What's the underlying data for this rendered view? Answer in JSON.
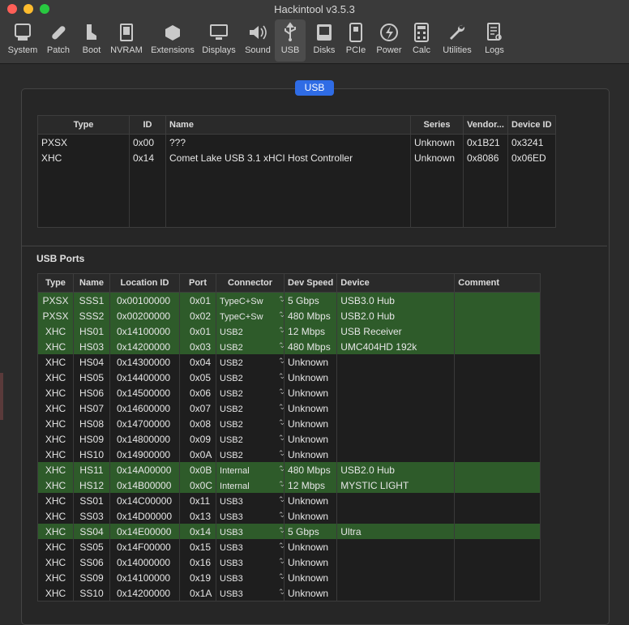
{
  "window": {
    "title": "Hackintool v3.5.3",
    "lights": [
      "#ff5f57",
      "#febc2e",
      "#28c840"
    ]
  },
  "toolbar": [
    {
      "label": "System",
      "icon": "system-icon"
    },
    {
      "label": "Patch",
      "icon": "bandage-icon"
    },
    {
      "label": "Boot",
      "icon": "boot-icon"
    },
    {
      "label": "NVRAM",
      "icon": "nvram-icon"
    },
    {
      "label": "Extensions",
      "icon": "extensions-icon"
    },
    {
      "label": "Displays",
      "icon": "display-icon"
    },
    {
      "label": "Sound",
      "icon": "speaker-icon"
    },
    {
      "label": "USB",
      "icon": "usb-icon"
    },
    {
      "label": "Disks",
      "icon": "disk-icon"
    },
    {
      "label": "PCIe",
      "icon": "pcie-icon"
    },
    {
      "label": "Power",
      "icon": "power-icon"
    },
    {
      "label": "Calc",
      "icon": "calculator-icon"
    },
    {
      "label": "Utilities",
      "icon": "wrench-icon"
    },
    {
      "label": "Logs",
      "icon": "logs-icon"
    }
  ],
  "segment": {
    "label": "USB"
  },
  "controllers": {
    "headers": [
      "Type",
      "ID",
      "Name",
      "Series",
      "Vendor...",
      "Device ID"
    ],
    "rows": [
      [
        "PXSX",
        "0x00",
        "???",
        "Unknown",
        "0x1B21",
        "0x3241"
      ],
      [
        "XHC",
        "0x14",
        "Comet Lake USB 3.1 xHCI Host Controller",
        "Unknown",
        "0x8086",
        "0x06ED"
      ]
    ]
  },
  "ports_section": {
    "title": "USB Ports"
  },
  "ports": {
    "headers": [
      "Type",
      "Name",
      "Location ID",
      "Port",
      "Connector",
      "Dev Speed",
      "Device",
      "Comment"
    ],
    "rows": [
      {
        "type": "PXSX",
        "name": "SSS1",
        "loc": "0x00100000",
        "port": "0x01",
        "conn": "TypeC+Sw",
        "speed": "5 Gbps",
        "device": "USB3.0 Hub",
        "comment": "",
        "active": true
      },
      {
        "type": "PXSX",
        "name": "SSS2",
        "loc": "0x00200000",
        "port": "0x02",
        "conn": "TypeC+Sw",
        "speed": "480 Mbps",
        "device": "USB2.0 Hub",
        "comment": "",
        "active": true
      },
      {
        "type": "XHC",
        "name": "HS01",
        "loc": "0x14100000",
        "port": "0x01",
        "conn": "USB2",
        "speed": "12 Mbps",
        "device": "USB Receiver",
        "comment": "",
        "active": true
      },
      {
        "type": "XHC",
        "name": "HS03",
        "loc": "0x14200000",
        "port": "0x03",
        "conn": "USB2",
        "speed": "480 Mbps",
        "device": "UMC404HD 192k",
        "comment": "",
        "active": true
      },
      {
        "type": "XHC",
        "name": "HS04",
        "loc": "0x14300000",
        "port": "0x04",
        "conn": "USB2",
        "speed": "Unknown",
        "device": "",
        "comment": "",
        "active": false
      },
      {
        "type": "XHC",
        "name": "HS05",
        "loc": "0x14400000",
        "port": "0x05",
        "conn": "USB2",
        "speed": "Unknown",
        "device": "",
        "comment": "",
        "active": false
      },
      {
        "type": "XHC",
        "name": "HS06",
        "loc": "0x14500000",
        "port": "0x06",
        "conn": "USB2",
        "speed": "Unknown",
        "device": "",
        "comment": "",
        "active": false
      },
      {
        "type": "XHC",
        "name": "HS07",
        "loc": "0x14600000",
        "port": "0x07",
        "conn": "USB2",
        "speed": "Unknown",
        "device": "",
        "comment": "",
        "active": false
      },
      {
        "type": "XHC",
        "name": "HS08",
        "loc": "0x14700000",
        "port": "0x08",
        "conn": "USB2",
        "speed": "Unknown",
        "device": "",
        "comment": "",
        "active": false
      },
      {
        "type": "XHC",
        "name": "HS09",
        "loc": "0x14800000",
        "port": "0x09",
        "conn": "USB2",
        "speed": "Unknown",
        "device": "",
        "comment": "",
        "active": false
      },
      {
        "type": "XHC",
        "name": "HS10",
        "loc": "0x14900000",
        "port": "0x0A",
        "conn": "USB2",
        "speed": "Unknown",
        "device": "",
        "comment": "",
        "active": false
      },
      {
        "type": "XHC",
        "name": "HS11",
        "loc": "0x14A00000",
        "port": "0x0B",
        "conn": "Internal",
        "speed": "480 Mbps",
        "device": "USB2.0 Hub",
        "comment": "",
        "active": true
      },
      {
        "type": "XHC",
        "name": "HS12",
        "loc": "0x14B00000",
        "port": "0x0C",
        "conn": "Internal",
        "speed": "12 Mbps",
        "device": "MYSTIC LIGHT",
        "comment": "",
        "active": true
      },
      {
        "type": "XHC",
        "name": "SS01",
        "loc": "0x14C00000",
        "port": "0x11",
        "conn": "USB3",
        "speed": "Unknown",
        "device": "",
        "comment": "",
        "active": false
      },
      {
        "type": "XHC",
        "name": "SS03",
        "loc": "0x14D00000",
        "port": "0x13",
        "conn": "USB3",
        "speed": "Unknown",
        "device": "",
        "comment": "",
        "active": false
      },
      {
        "type": "XHC",
        "name": "SS04",
        "loc": "0x14E00000",
        "port": "0x14",
        "conn": "USB3",
        "speed": "5 Gbps",
        "device": "Ultra",
        "comment": "",
        "active": true
      },
      {
        "type": "XHC",
        "name": "SS05",
        "loc": "0x14F00000",
        "port": "0x15",
        "conn": "USB3",
        "speed": "Unknown",
        "device": "",
        "comment": "",
        "active": false
      },
      {
        "type": "XHC",
        "name": "SS06",
        "loc": "0x14000000",
        "port": "0x16",
        "conn": "USB3",
        "speed": "Unknown",
        "device": "",
        "comment": "",
        "active": false
      },
      {
        "type": "XHC",
        "name": "SS09",
        "loc": "0x14100000",
        "port": "0x19",
        "conn": "USB3",
        "speed": "Unknown",
        "device": "",
        "comment": "",
        "active": false
      },
      {
        "type": "XHC",
        "name": "SS10",
        "loc": "0x14200000",
        "port": "0x1A",
        "conn": "USB3",
        "speed": "Unknown",
        "device": "",
        "comment": "",
        "active": false
      }
    ]
  }
}
